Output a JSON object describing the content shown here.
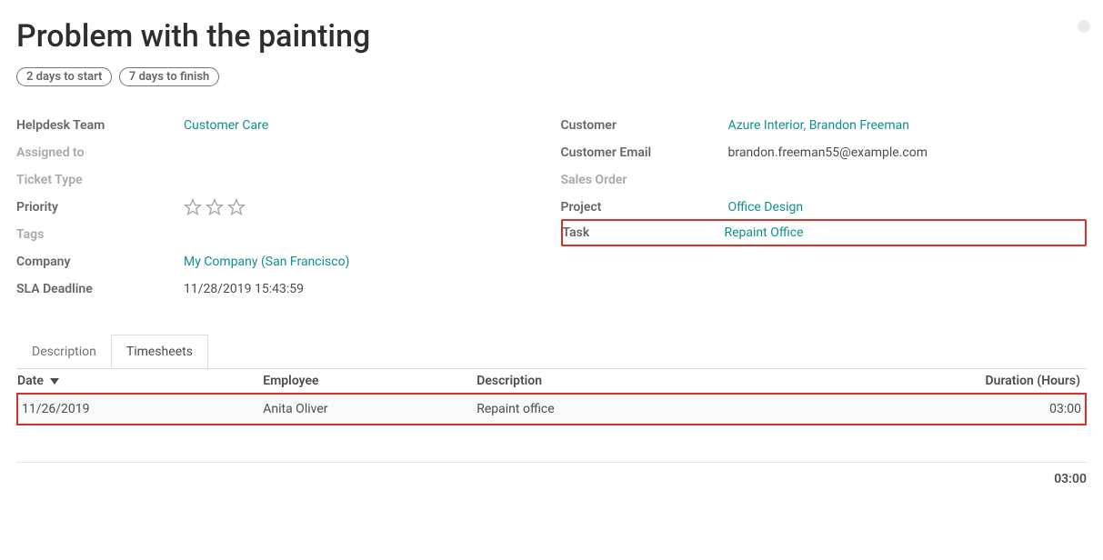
{
  "title": "Problem with the painting",
  "pills": {
    "start": "2 days to start",
    "finish": "7 days to finish"
  },
  "left": {
    "helpdesk_team_label": "Helpdesk Team",
    "helpdesk_team_value": "Customer Care",
    "assigned_to_label": "Assigned to",
    "ticket_type_label": "Ticket Type",
    "priority_label": "Priority",
    "tags_label": "Tags",
    "company_label": "Company",
    "company_value": "My Company (San Francisco)",
    "sla_label": "SLA Deadline",
    "sla_value": "11/28/2019 15:43:59"
  },
  "right": {
    "customer_label": "Customer",
    "customer_value": "Azure Interior, Brandon Freeman",
    "email_label": "Customer Email",
    "email_value": "brandon.freeman55@example.com",
    "sales_order_label": "Sales Order",
    "project_label": "Project",
    "project_value": "Office Design",
    "task_label": "Task",
    "task_value": "Repaint Office"
  },
  "tabs": {
    "description": "Description",
    "timesheets": "Timesheets"
  },
  "timesheet_headers": {
    "date": "Date",
    "employee": "Employee",
    "description": "Description",
    "duration": "Duration (Hours)"
  },
  "timesheet_rows": [
    {
      "date": "11/26/2019",
      "employee": "Anita Oliver",
      "description": "Repaint office",
      "duration": "03:00"
    }
  ],
  "footer_total": "03:00"
}
